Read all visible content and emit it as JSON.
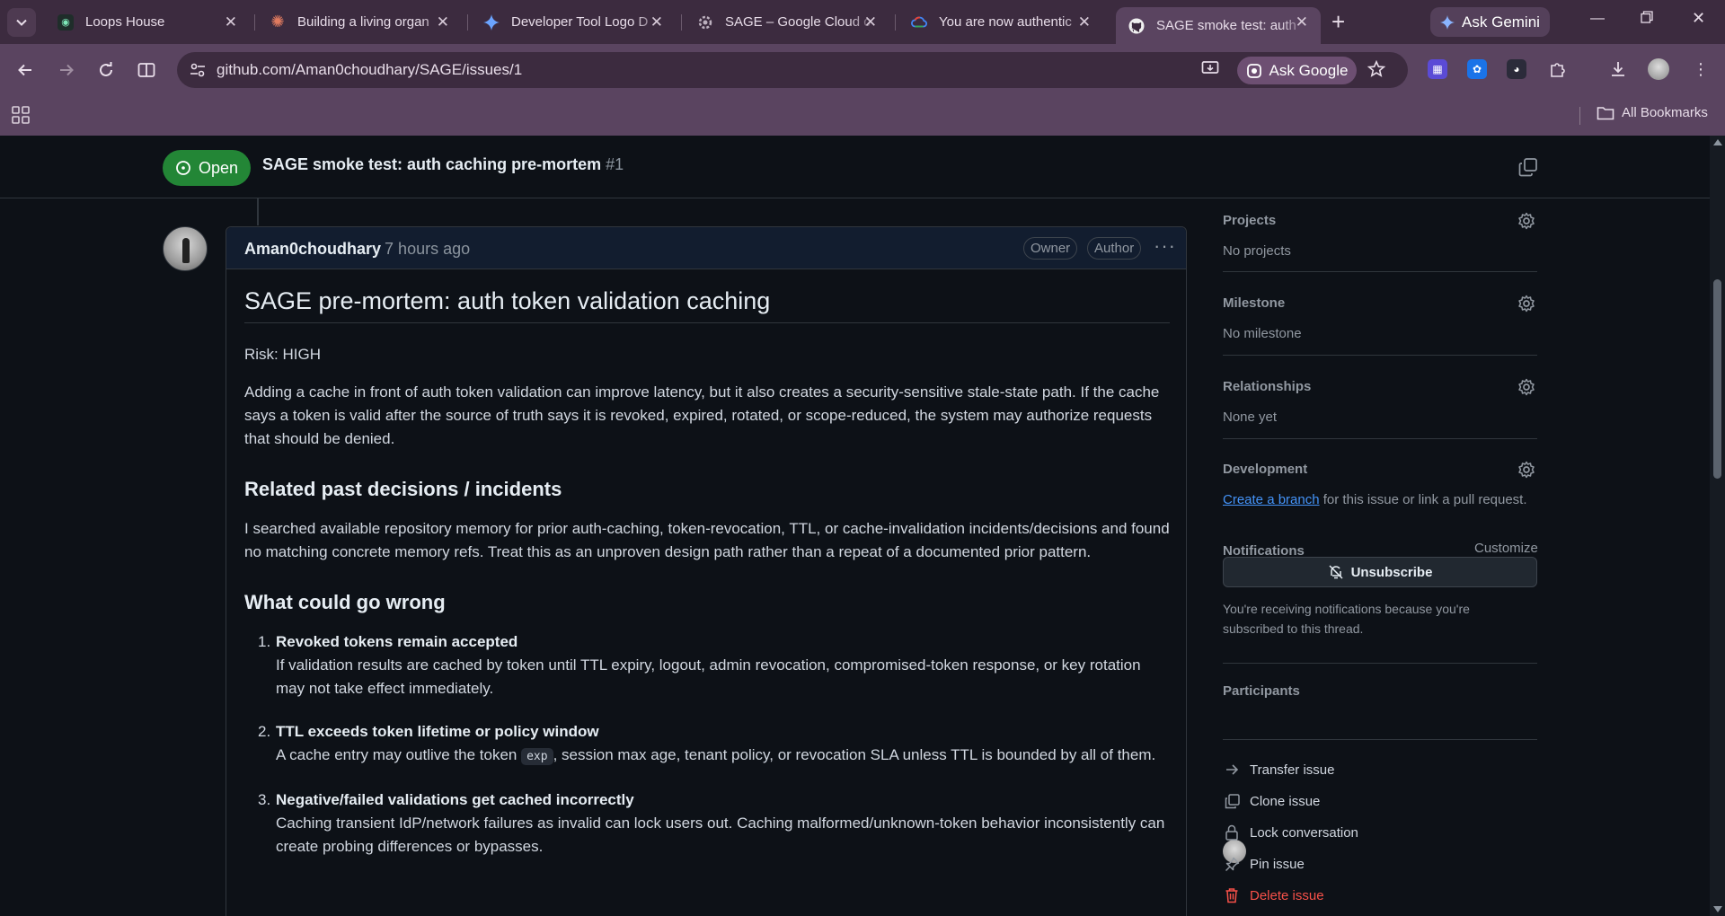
{
  "browser": {
    "tabs": [
      {
        "label": "Loops House",
        "active": false
      },
      {
        "label": "Building a living organ",
        "active": false
      },
      {
        "label": "Developer Tool Logo D",
        "active": false
      },
      {
        "label": "SAGE – Google Cloud c",
        "active": false
      },
      {
        "label": "You are now authentic",
        "active": false
      },
      {
        "label": "SAGE smoke test: auth",
        "active": true
      }
    ],
    "ask_gemini": "Ask Gemini",
    "url": "github.com/Aman0choudhary/SAGE/issues/1",
    "ask_google": "Ask Google",
    "all_bookmarks": "All Bookmarks"
  },
  "issue": {
    "state": "Open",
    "title": "SAGE smoke test: auth caching pre-mortem",
    "number": "#1"
  },
  "comment": {
    "author": "Aman0choudhary",
    "time": "7 hours ago",
    "badges": [
      "Owner",
      "Author"
    ],
    "heading": "SAGE pre-mortem: auth token validation caching",
    "risk": "Risk: HIGH",
    "intro": "Adding a cache in front of auth token validation can improve latency, but it also creates a security-sensitive stale-state path. If the cache says a token is valid after the source of truth says it is revoked, expired, rotated, or scope-reduced, the system may authorize requests that should be denied.",
    "section1_title": "Related past decisions / incidents",
    "section1_text": "I searched available repository memory for prior auth-caching, token-revocation, TTL, or cache-invalidation incidents/decisions and found no matching concrete memory refs. Treat this as an unproven design path rather than a repeat of a documented prior pattern.",
    "section2_title": "What could go wrong",
    "items": [
      {
        "num": "1.",
        "title": "Revoked tokens remain accepted",
        "text": "If validation results are cached by token until TTL expiry, logout, admin revocation, compromised-token response, or key rotation may not take effect immediately."
      },
      {
        "num": "2.",
        "title": "TTL exceeds token lifetime or policy window",
        "text_before": "A cache entry may outlive the token ",
        "code": "exp",
        "text_after": ", session max age, tenant policy, or revocation SLA unless TTL is bounded by all of them."
      },
      {
        "num": "3.",
        "title": "Negative/failed validations get cached incorrectly",
        "text": "Caching transient IdP/network failures as invalid can lock users out. Caching malformed/unknown-token behavior inconsistently can create probing differences or bypasses."
      }
    ]
  },
  "sidebar": {
    "projects": {
      "title": "Projects",
      "value": "No projects"
    },
    "milestone": {
      "title": "Milestone",
      "value": "No milestone"
    },
    "relationships": {
      "title": "Relationships",
      "value": "None yet"
    },
    "development": {
      "title": "Development",
      "link": "Create a branch",
      "rest": " for this issue or link a pull request."
    },
    "notifications": {
      "title": "Notifications",
      "customize": "Customize",
      "button": "Unsubscribe",
      "note": "You're receiving notifications because you're subscribed to this thread."
    },
    "participants": {
      "title": "Participants"
    },
    "actions": [
      {
        "label": "Transfer issue",
        "icon": "arrow-right-icon"
      },
      {
        "label": "Clone issue",
        "icon": "copy-icon"
      },
      {
        "label": "Lock conversation",
        "icon": "lock-icon"
      },
      {
        "label": "Pin issue",
        "icon": "pin-icon"
      },
      {
        "label": "Delete issue",
        "icon": "trash-icon"
      }
    ]
  },
  "colors": {
    "open": "#238636",
    "link": "#4493f8",
    "danger": "#f85149",
    "chrome": "#5a4460"
  }
}
